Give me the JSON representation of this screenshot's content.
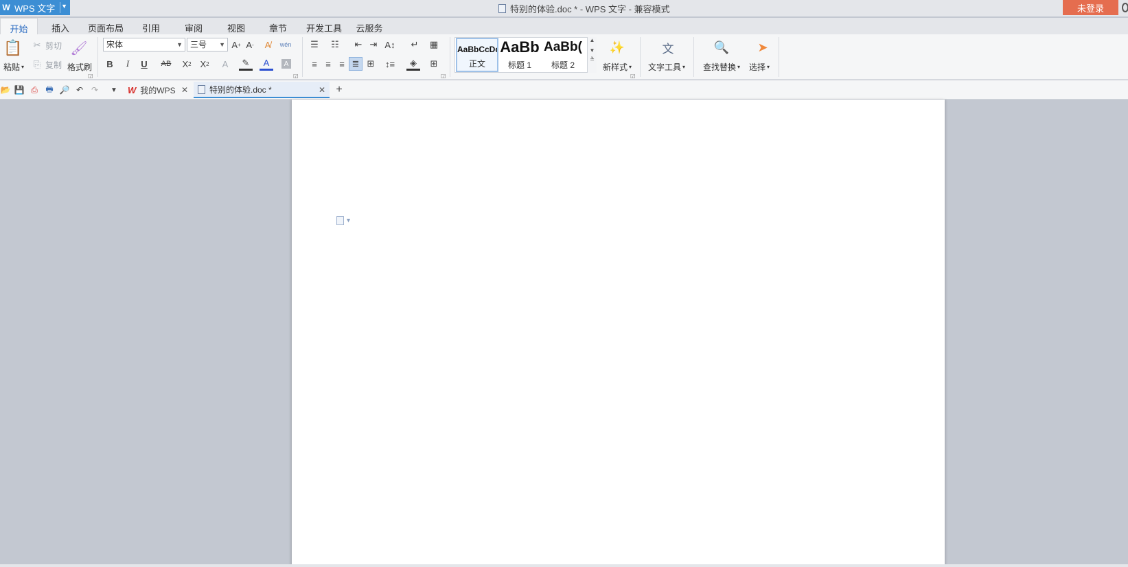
{
  "titlebar": {
    "app_name": "WPS 文字",
    "doc_title": "特别的体验.doc * - WPS 文字 - 兼容模式",
    "login_label": "未登录"
  },
  "menu_tabs": [
    "开始",
    "插入",
    "页面布局",
    "引用",
    "审阅",
    "视图",
    "章节",
    "开发工具",
    "云服务"
  ],
  "ribbon": {
    "paste": "粘贴",
    "cut": "剪切",
    "copy": "复制",
    "format_painter": "格式刷",
    "font_name": "宋体",
    "font_size": "三号",
    "styles": [
      {
        "sample": "AaBbCcDd",
        "caption": "正文"
      },
      {
        "sample": "AaBb",
        "caption": "标题 1"
      },
      {
        "sample": "AaBb(",
        "caption": "标题 2"
      }
    ],
    "new_style": "新样式",
    "text_tools": "文字工具",
    "find_replace": "查找替换",
    "select": "选择"
  },
  "doc_tabs": [
    {
      "label": "我的WPS"
    },
    {
      "label": "特别的体验.doc *"
    }
  ],
  "colors": {
    "accent_blue": "#3c8ed4",
    "login_orange": "#e56d4f",
    "workspace_gray": "#c3c8d1"
  }
}
